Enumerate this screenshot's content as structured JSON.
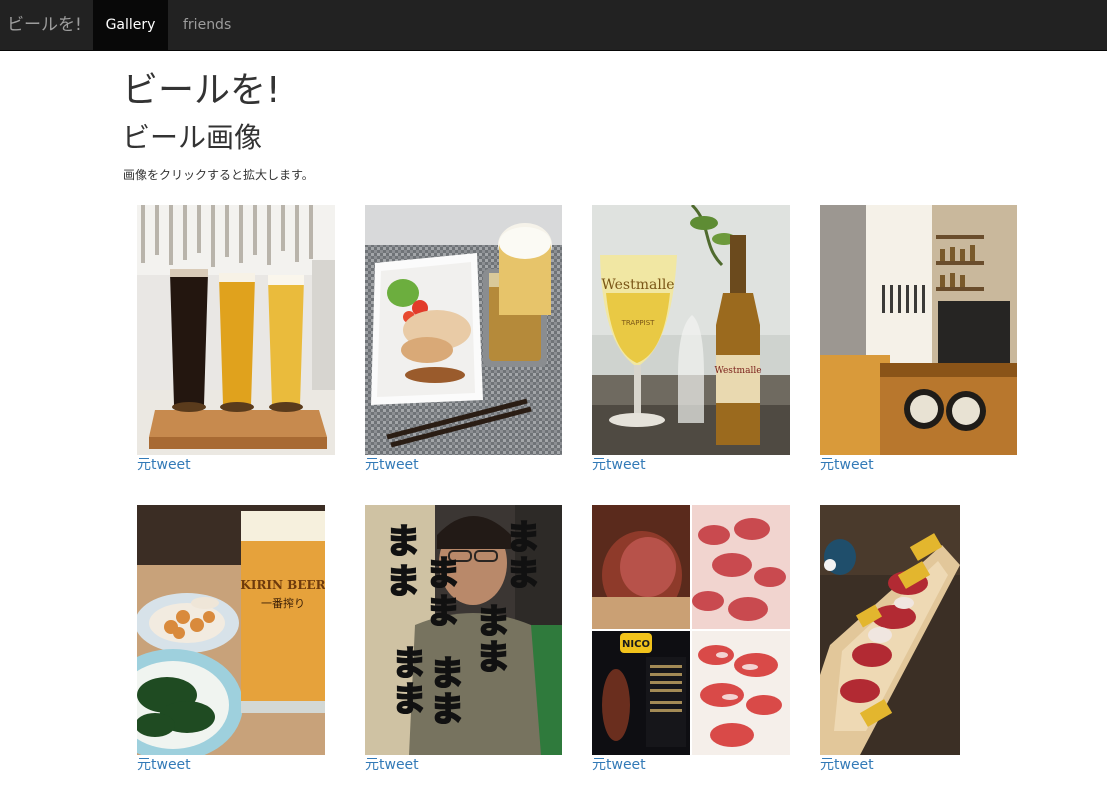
{
  "navbar": {
    "brand": "ビールを!",
    "items": [
      {
        "label": "Gallery",
        "active": true
      },
      {
        "label": "friends",
        "active": false
      }
    ]
  },
  "header": {
    "title": "ビールを!",
    "subtitle": "ビール画像",
    "description": "画像をクリックすると拡大します。"
  },
  "gallery": {
    "link_color": "#337ab7",
    "items": [
      {
        "link": "元tweet"
      },
      {
        "link": "元tweet"
      },
      {
        "link": "元tweet"
      },
      {
        "link": "元tweet"
      },
      {
        "link": "元tweet"
      },
      {
        "link": "元tweet"
      },
      {
        "link": "元tweet"
      },
      {
        "link": "元tweet"
      }
    ]
  },
  "photo_text": {
    "photo3_bottle": "Westmalle",
    "photo3_glass": "Westmalle",
    "photo3_glass_sub": "TRAPPIST",
    "photo5_glass": "KIRIN BEER",
    "photo5_glass_sub": "一番搾り",
    "photo6_char": "ま",
    "photo7_brand": "NICO"
  }
}
